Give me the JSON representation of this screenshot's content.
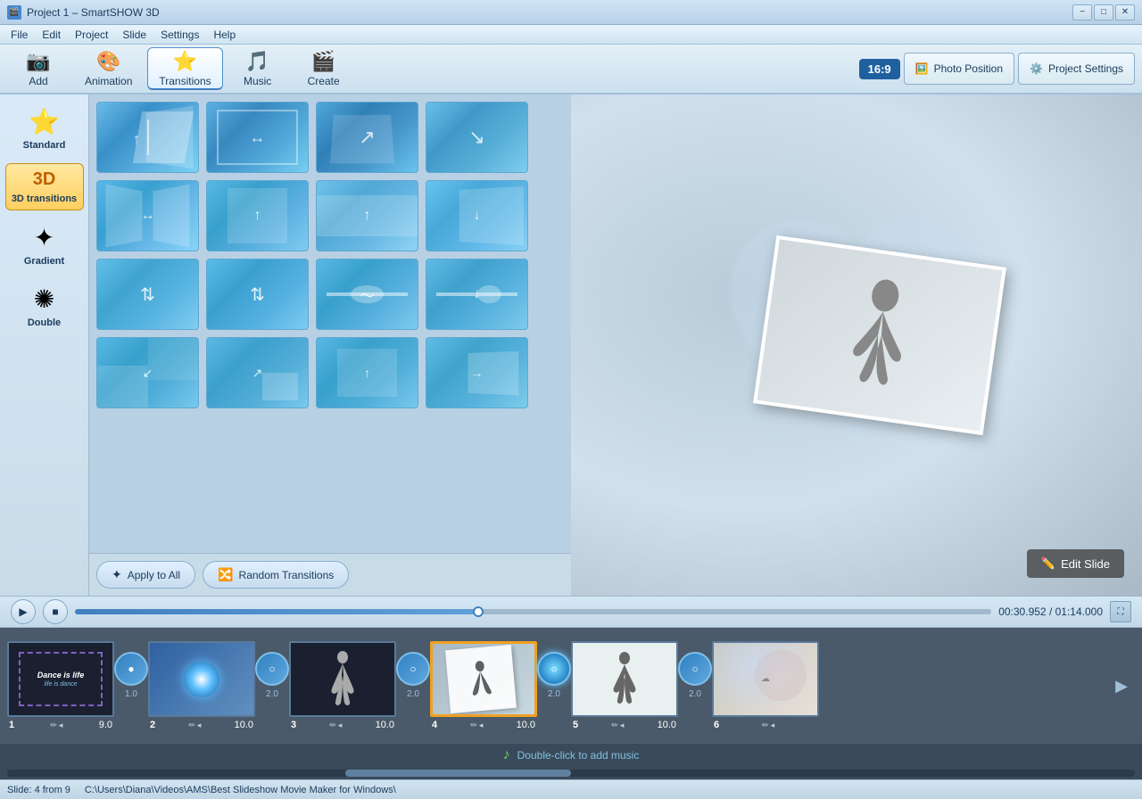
{
  "window": {
    "title": "Project 1 – SmartSHOW 3D",
    "icon": "🎬"
  },
  "titlebar": {
    "title": "Project 1 – SmartSHOW 3D",
    "min_btn": "−",
    "max_btn": "□",
    "close_btn": "✕"
  },
  "menubar": {
    "items": [
      "File",
      "Edit",
      "Project",
      "Slide",
      "Settings",
      "Help"
    ]
  },
  "toolbar": {
    "add_label": "Add",
    "animation_label": "Animation",
    "transitions_label": "Transitions",
    "music_label": "Music",
    "create_label": "Create",
    "ratio": "16:9",
    "photo_position_label": "Photo Position",
    "project_settings_label": "Project Settings"
  },
  "categories": [
    {
      "id": "standard",
      "label": "Standard",
      "icon": "⭐",
      "active": false
    },
    {
      "id": "3d",
      "label": "3D transitions",
      "icon": "3D",
      "active": true
    },
    {
      "id": "gradient",
      "label": "Gradient",
      "icon": "✦",
      "active": false
    },
    {
      "id": "double",
      "label": "Double",
      "icon": "✺",
      "active": false
    }
  ],
  "transitions": {
    "rows": [
      [
        "fold-left",
        "fold-right",
        "fold-corner",
        "fold-diagonal"
      ],
      [
        "book-open",
        "door-open",
        "lift-up",
        "box-drop"
      ],
      [
        "arrows-left",
        "arrows-center",
        "wave-h",
        "wave-side"
      ],
      [
        "stripe-left",
        "stripe-corner",
        "slide-panel",
        "slide-reveal"
      ]
    ]
  },
  "bottom_buttons": {
    "apply_label": "Apply to All",
    "random_label": "Random Transitions"
  },
  "preview": {
    "edit_slide_label": "Edit Slide"
  },
  "player": {
    "current_time": "00:30.952",
    "total_time": "01:14.000",
    "progress_percent": 44
  },
  "timeline": {
    "slides": [
      {
        "num": "1",
        "duration": "9.0",
        "type": "title"
      },
      {
        "num": "2",
        "duration": "10.0",
        "type": "dark"
      },
      {
        "num": "3",
        "duration": "10.0",
        "type": "dancer"
      },
      {
        "num": "4",
        "duration": "10.0",
        "type": "inkdancer",
        "selected": true
      },
      {
        "num": "5",
        "duration": "10.0",
        "type": "white-dancer"
      },
      {
        "num": "6",
        "duration": "",
        "type": "clouds"
      }
    ],
    "transitions": [
      {
        "between": "1-2",
        "duration": "1.0"
      },
      {
        "between": "2-3",
        "duration": "2.0"
      },
      {
        "between": "3-4",
        "duration": "2.0"
      },
      {
        "between": "4-5",
        "duration": "2.0"
      },
      {
        "between": "5-6",
        "duration": "2.0"
      }
    ]
  },
  "music": {
    "prompt": "Double-click to add music"
  },
  "statusbar": {
    "slide_info": "Slide: 4 from 9",
    "file_path": "C:\\Users\\Diana\\Videos\\AMS\\Best Slideshow Movie Maker for Windows\\"
  }
}
